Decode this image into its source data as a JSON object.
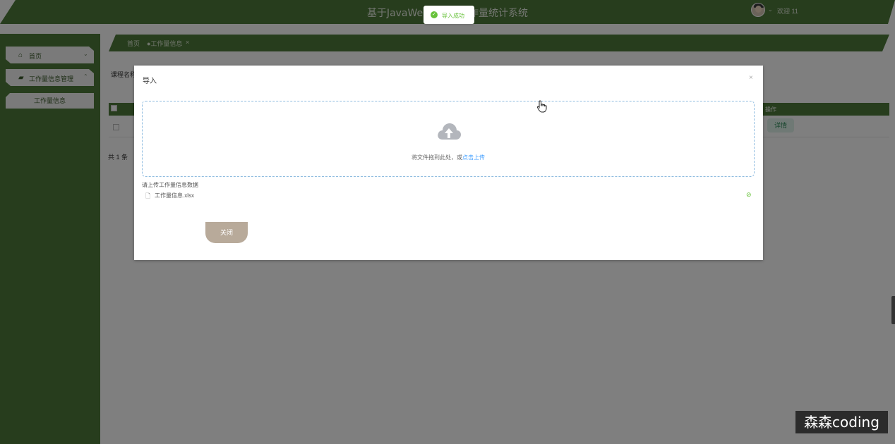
{
  "header": {
    "title": "基于JavaWeb的教师工作量统计系统",
    "welcome": "欢迎 11"
  },
  "sidebar": {
    "items": [
      {
        "label": "首页",
        "icon": "home-icon"
      },
      {
        "label": "工作量信息管理",
        "icon": "briefcase-icon"
      }
    ],
    "subitems": [
      {
        "label": "工作量信息"
      }
    ]
  },
  "tags": {
    "home": "首页",
    "current": "●工作量信息",
    "close": "×"
  },
  "page": {
    "filter_label": "课程名称",
    "op_header": "操作",
    "detail_btn": "详情",
    "total": "共 1 条"
  },
  "dialog": {
    "title": "导入",
    "close": "×",
    "drop_text": "将文件拖到此处，或",
    "drop_link": "点击上传",
    "tip": "请上传工作量信息数据",
    "file_name": "工作量信息.xlsx",
    "close_button": "关闭"
  },
  "toast": {
    "text": "导入成功"
  },
  "watermark": "森森coding",
  "colors": {
    "primary_green": "#4e7a3a",
    "link_blue": "#409eff",
    "success_green": "#67c23a",
    "close_button": "#b8aa9a"
  }
}
